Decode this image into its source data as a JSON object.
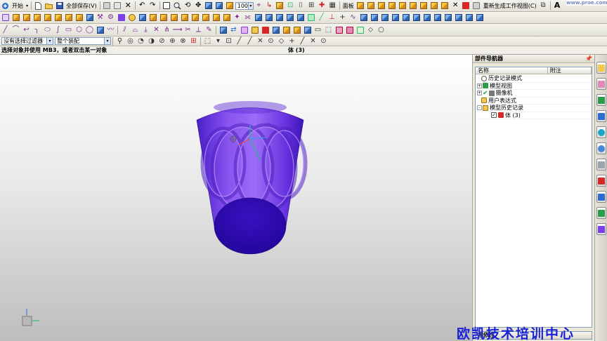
{
  "toolbar_main": {
    "start_label": "开始",
    "save_all_label": "全部保存(V)",
    "zoom_value": "100",
    "sheet_label": "面板",
    "regen_label": "重新生成工作视图(C)"
  },
  "selection_bar": {
    "filter_value": "没有选择过滤器",
    "assembly_value": "整个装配"
  },
  "status": {
    "prompt": "选择对象并使用 MB3，或者双击某一对象",
    "selection": "体 (3)"
  },
  "navigator": {
    "title": "部件导航器",
    "col_name": "名称",
    "col_note": "附注",
    "tree": [
      {
        "label": "历史记录模式",
        "icon": "clock-icon",
        "expander": ""
      },
      {
        "label": "模型视图",
        "icon": "views-icon",
        "expander": "+"
      },
      {
        "label": "摄像机",
        "icon": "camera-icon",
        "expander": "+"
      },
      {
        "label": "用户表达式",
        "icon": "folder-icon",
        "expander": ""
      },
      {
        "label": "模型历史记录",
        "icon": "folder-icon",
        "expander": "-"
      },
      {
        "label": "体 (3)",
        "icon": "body-icon",
        "expander": ""
      }
    ],
    "dependencies_label": "相依性"
  },
  "watermark_top": "www.proe.com",
  "watermark_bottom": "欧凯技术培训中心",
  "colors": {
    "model_main": "#7a3fe6",
    "model_dark": "#2e0b9a",
    "watermark_bottom": "#1b22d8"
  }
}
